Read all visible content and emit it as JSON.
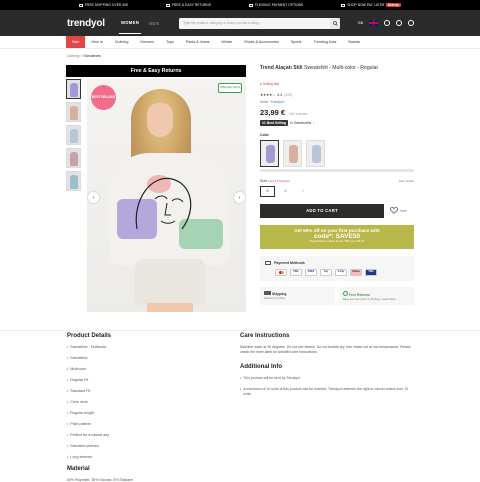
{
  "topbar": {
    "items": [
      {
        "label": "FREE SHIPPING OVER 50€"
      },
      {
        "label": "FREE & EASY RETURNS"
      },
      {
        "label": "FLEXIBLE PAYMENT OPTIONS"
      },
      {
        "label": "SHOP NOW PAY LATER"
      }
    ],
    "klarna": "Klarna."
  },
  "header": {
    "logo": "trendyol",
    "gender_tabs": [
      "WOMEN",
      "MEN"
    ],
    "search_placeholder": "Type the product, category or brand you are looking...",
    "currency": "GB"
  },
  "nav": {
    "items": [
      "Sale",
      "New In",
      "Clothing",
      "Dresses",
      "Tops",
      "Pants & Jeans",
      "Winter",
      "Shoes & Accessories",
      "Sports",
      "Trending Now",
      "Brands"
    ]
  },
  "breadcrumb": {
    "parent": "Clothing",
    "sep": ">",
    "current": "Sweatshirts"
  },
  "gallery": {
    "banner": "Free & Easy Returns",
    "best_selling": "BEST SELLING",
    "free_returns": "FREE RETURNS",
    "prev_arrow": "‹",
    "next_arrow": "›",
    "colors": {
      "swatch1": "#a39ad4",
      "swatch2": "#d8b09e",
      "swatch3": "#b9c6d9",
      "swatch4": "#c7a3a9",
      "swatch5": "#9cbcd0"
    }
  },
  "product": {
    "brand": "Trend Alaçatı Stili",
    "name": "Sweatshirt - Multi-color - Regular",
    "tag": "Selling fast",
    "stars": "★★★★☆",
    "rating_value": "4.4",
    "rating_count": "(229)",
    "seller_label": "Seller:",
    "seller_name": "Trendyol",
    "price": "23,99 €",
    "price_note": "VAT included",
    "rank_badge": "#1 Best Selling",
    "rank_text": "in Sweatshirts",
    "color_label": "Color",
    "size_label": "Size",
    "size_note": "Last 2 Products!",
    "size_chart": "Size Guide",
    "sizes": [
      "S",
      "M",
      "L"
    ],
    "add_to_cart": "ADD TO CART",
    "fav_label": "Save",
    "accent": "#b8b84a"
  },
  "promo": {
    "line1": "Get 50% off on your first purchase with",
    "code": "code*: SAVE50",
    "fine": "*Applicable for orders of min. 50€ over 30€ off."
  },
  "payment": {
    "title": "Payment Methods",
    "methods": [
      "MC",
      "VISA",
      "AMEX",
      "Pay",
      "G Pay",
      "Klarna",
      "VISA"
    ]
  },
  "shipping": {
    "title": "Shipping",
    "sub": "Delivery in 5 days"
  },
  "returns": {
    "title": "Free Returns",
    "sub": "Easy and free return in 30 days. Learn More"
  },
  "details": {
    "title": "Product Details",
    "items": [
      "Sweatshirt - Multicolor",
      "Sweatshirt",
      "Multicolor",
      "Regular Fit",
      "Standard Fit",
      "Crew neck",
      "Regular length",
      "Plain pattern",
      "Perfect for a casual day",
      "Standard sleeves",
      "Long sleeves"
    ]
  },
  "care": {
    "title": "Care Instructions",
    "text": "Machine wash at 30 degrees. Do not use bleach. Do not tumble dry. Iron inside out at low temperature. Please check the inner label for detailed care instructions."
  },
  "additional": {
    "title": "Additional Info",
    "items": [
      "This product will be sent by Trendyol.",
      "A maximum of 10 units of this product can be ordered. Trendyol reserves the right to cancel orders over 10 units."
    ]
  },
  "material": {
    "title": "Material",
    "text": "60% Polyester, 35% Viscose, 5% Elastane"
  }
}
